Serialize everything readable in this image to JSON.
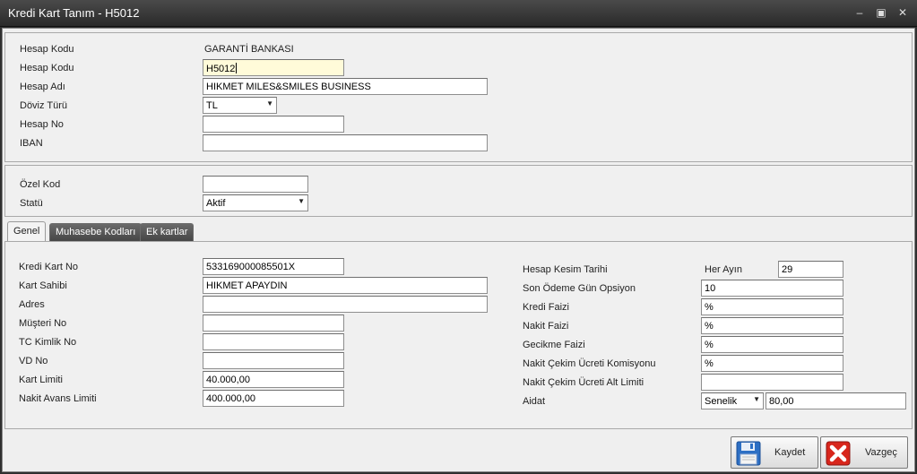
{
  "window": {
    "title": "Kredi Kart Tanım - H5012",
    "minimize": "–",
    "maximize": "▣",
    "close": "✕"
  },
  "top": {
    "bank_label": "Hesap Kodu",
    "bank_value": "GARANTİ BANKASI",
    "code_label": "Hesap Kodu",
    "code_value": "H5012",
    "name_label": "Hesap Adı",
    "name_value": "HIKMET MILES&SMILES BUSINESS",
    "currency_label": "Döviz Türü",
    "currency_value": "TL",
    "account_no_label": "Hesap No",
    "account_no_value": "",
    "iban_label": "IBAN",
    "iban_value": ""
  },
  "middle": {
    "special_code_label": "Özel Kod",
    "special_code_value": "",
    "status_label": "Statü",
    "status_value": "Aktif"
  },
  "tabs": {
    "general": "Genel",
    "accounting": "Muhasebe Kodları",
    "extra_cards": "Ek kartlar"
  },
  "left": {
    "card_no_label": "Kredi Kart No",
    "card_no_value": "533169000085501X",
    "holder_label": "Kart Sahibi",
    "holder_value": "HIKMET APAYDIN",
    "address_label": "Adres",
    "address_value": "",
    "customer_no_label": "Müşteri No",
    "customer_no_value": "",
    "tc_label": "TC Kimlik No",
    "tc_value": "",
    "vd_label": "VD No",
    "vd_value": "",
    "limit_label": "Kart Limiti",
    "limit_value": "40.000,00",
    "cash_limit_label": "Nakit Avans Limiti",
    "cash_limit_value": "400.000,00"
  },
  "right": {
    "statement_label": "Hesap Kesim Tarihi",
    "statement_every": "Her Ayın",
    "statement_value": "29",
    "due_label": "Son Ödeme Gün Opsiyon",
    "due_value": "10",
    "credit_interest_label": "Kredi Faizi",
    "credit_interest_value": "%",
    "cash_interest_label": "Nakit Faizi",
    "cash_interest_value": "%",
    "late_interest_label": "Gecikme Faizi",
    "late_interest_value": "%",
    "cash_fee_label": "Nakit Çekim Ücreti Komisyonu",
    "cash_fee_value": "%",
    "cash_fee_min_label": "Nakit Çekim Ücreti Alt Limiti",
    "cash_fee_min_value": "",
    "fee_label": "Aidat",
    "fee_period": "Senelik",
    "fee_value": "80,00"
  },
  "buttons": {
    "save": "Kaydet",
    "cancel": "Vazgeç"
  },
  "colors": {
    "focus_field": "#fffbd9",
    "save_icon": "#2d6fc4",
    "cancel_icon": "#d8261c"
  },
  "icons": {
    "save": "floppy-disk-icon",
    "cancel": "red-x-icon",
    "dropdown": "chevron-down-icon"
  }
}
